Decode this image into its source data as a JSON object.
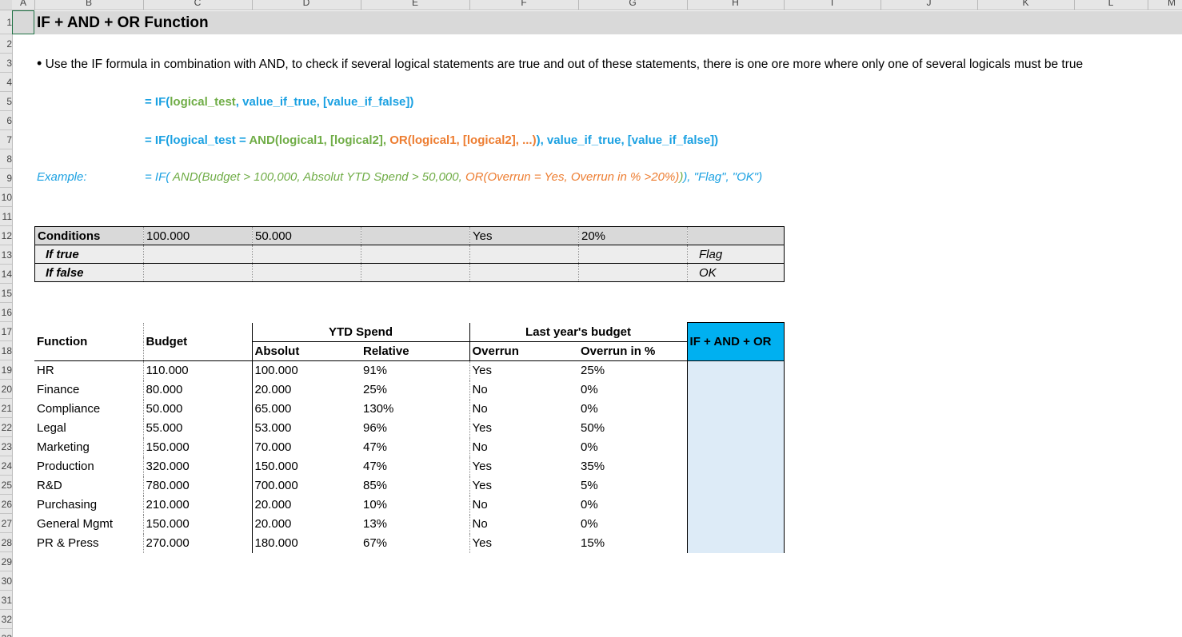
{
  "sheet": {
    "columns": [
      "A",
      "B",
      "C",
      "D",
      "E",
      "F",
      "G",
      "H",
      "I",
      "J",
      "K",
      "L",
      "M"
    ],
    "rows": [
      "1",
      "2",
      "3",
      "4",
      "5",
      "6",
      "7",
      "8",
      "9",
      "10",
      "11",
      "12",
      "13",
      "14",
      "15",
      "16",
      "17",
      "18",
      "19",
      "20",
      "21",
      "22",
      "23",
      "24",
      "25",
      "26",
      "27",
      "28",
      "29",
      "30",
      "31",
      "32",
      "33"
    ]
  },
  "title": "IF + AND + OR Function",
  "description": "Use the IF formula in combination with AND, to check if several logical statements are true and out of these statements, there is one ore more where only one of several logicals must be true",
  "syntax1": {
    "p1": "= IF(",
    "p2": "logical_test",
    "p3": ", value_if_true, [value_if_false])"
  },
  "syntax2": {
    "p1": "= IF(logical_test = ",
    "p2": "AND(logical1, [logical2], ",
    "p3": "OR(logical1, [logical2], ...)",
    "p4": "), value_if_true, [value_if_false])"
  },
  "example": {
    "label": "Example:",
    "p1": "= IF( ",
    "p2": "AND(Budget > 100,000, Absolut YTD Spend > 50,000, ",
    "p3": "OR(Overrun = Yes, Overrun in % >20%)",
    "p4": ")",
    "p5": "), \"Flag\", \"OK\")"
  },
  "conditions": {
    "label": "Conditions",
    "budget": "100.000",
    "absolut": "50.000",
    "overrun": "Yes",
    "overrun_pct": "20%",
    "if_true_label": "If true",
    "if_true_value": "Flag",
    "if_false_label": "If false",
    "if_false_value": "OK"
  },
  "table": {
    "headers": {
      "function": "Function",
      "budget": "Budget",
      "ytd_spend": "YTD Spend",
      "absolut": "Absolut",
      "relative": "Relative",
      "last_year": "Last year's budget",
      "overrun": "Overrun",
      "overrun_pct": "Overrun in %",
      "result": "IF + AND + OR"
    },
    "rows": [
      {
        "function": "HR",
        "budget": "110.000",
        "absolut": "100.000",
        "relative": "91%",
        "overrun": "Yes",
        "overrun_pct": "25%"
      },
      {
        "function": "Finance",
        "budget": "80.000",
        "absolut": "20.000",
        "relative": "25%",
        "overrun": "No",
        "overrun_pct": "0%"
      },
      {
        "function": "Compliance",
        "budget": "50.000",
        "absolut": "65.000",
        "relative": "130%",
        "overrun": "No",
        "overrun_pct": "0%"
      },
      {
        "function": "Legal",
        "budget": "55.000",
        "absolut": "53.000",
        "relative": "96%",
        "overrun": "Yes",
        "overrun_pct": "50%"
      },
      {
        "function": "Marketing",
        "budget": "150.000",
        "absolut": "70.000",
        "relative": "47%",
        "overrun": "No",
        "overrun_pct": "0%"
      },
      {
        "function": "Production",
        "budget": "320.000",
        "absolut": "150.000",
        "relative": "47%",
        "overrun": "Yes",
        "overrun_pct": "35%"
      },
      {
        "function": "R&D",
        "budget": "780.000",
        "absolut": "700.000",
        "relative": "85%",
        "overrun": "Yes",
        "overrun_pct": "5%"
      },
      {
        "function": "Purchasing",
        "budget": "210.000",
        "absolut": "20.000",
        "relative": "10%",
        "overrun": "No",
        "overrun_pct": "0%"
      },
      {
        "function": "General Mgmt",
        "budget": "150.000",
        "absolut": "20.000",
        "relative": "13%",
        "overrun": "No",
        "overrun_pct": "0%"
      },
      {
        "function": "PR & Press",
        "budget": "270.000",
        "absolut": "180.000",
        "relative": "67%",
        "overrun": "Yes",
        "overrun_pct": "15%"
      }
    ]
  },
  "colors": {
    "blue": "#1ba1e2",
    "green": "#70ad47",
    "orange": "#ed7d31",
    "result_header": "#00b0f0",
    "result_fill": "#ddebf7",
    "title_band": "#d9d9d9"
  }
}
